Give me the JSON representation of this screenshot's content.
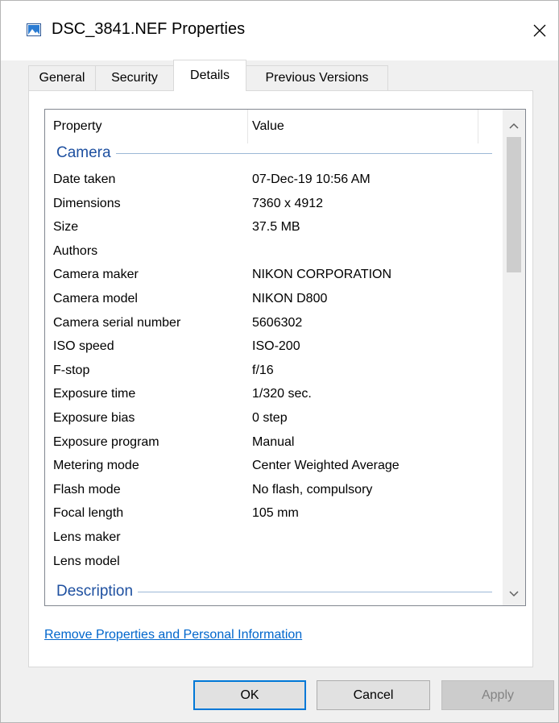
{
  "window": {
    "title": "DSC_3841.NEF Properties",
    "close_glyph": "✕"
  },
  "tabs": [
    {
      "label": "General",
      "active": false
    },
    {
      "label": "Security",
      "active": false
    },
    {
      "label": "Details",
      "active": true
    },
    {
      "label": "Previous Versions",
      "active": false
    }
  ],
  "details": {
    "columns": {
      "property": "Property",
      "value": "Value"
    },
    "groups": {
      "camera": "Camera",
      "description": "Description"
    },
    "rows": [
      {
        "property": "Date taken",
        "value": "07-Dec-19 10:56 AM"
      },
      {
        "property": "Dimensions",
        "value": "7360 x 4912"
      },
      {
        "property": "Size",
        "value": "37.5 MB"
      },
      {
        "property": "Authors",
        "value": ""
      },
      {
        "property": "Camera maker",
        "value": "NIKON CORPORATION"
      },
      {
        "property": "Camera model",
        "value": "NIKON D800"
      },
      {
        "property": "Camera serial number",
        "value": "5606302"
      },
      {
        "property": "ISO speed",
        "value": "ISO-200"
      },
      {
        "property": "F-stop",
        "value": "f/16"
      },
      {
        "property": "Exposure time",
        "value": "1/320 sec."
      },
      {
        "property": "Exposure bias",
        "value": "0 step"
      },
      {
        "property": "Exposure program",
        "value": "Manual"
      },
      {
        "property": "Metering mode",
        "value": "Center Weighted Average"
      },
      {
        "property": "Flash mode",
        "value": "No flash, compulsory"
      },
      {
        "property": "Focal length",
        "value": "105 mm"
      },
      {
        "property": "Lens maker",
        "value": ""
      },
      {
        "property": "Lens model",
        "value": ""
      }
    ]
  },
  "remove_link": "Remove Properties and Personal Information",
  "buttons": {
    "ok": "OK",
    "cancel": "Cancel",
    "apply": "Apply"
  },
  "colors": {
    "accent": "#0078d7",
    "link": "#0066cc",
    "group_header": "#1e50a0"
  },
  "icons": {
    "file": "image-file-icon",
    "close": "close-icon",
    "scroll_up": "chevron-up-icon",
    "scroll_down": "chevron-down-icon"
  }
}
